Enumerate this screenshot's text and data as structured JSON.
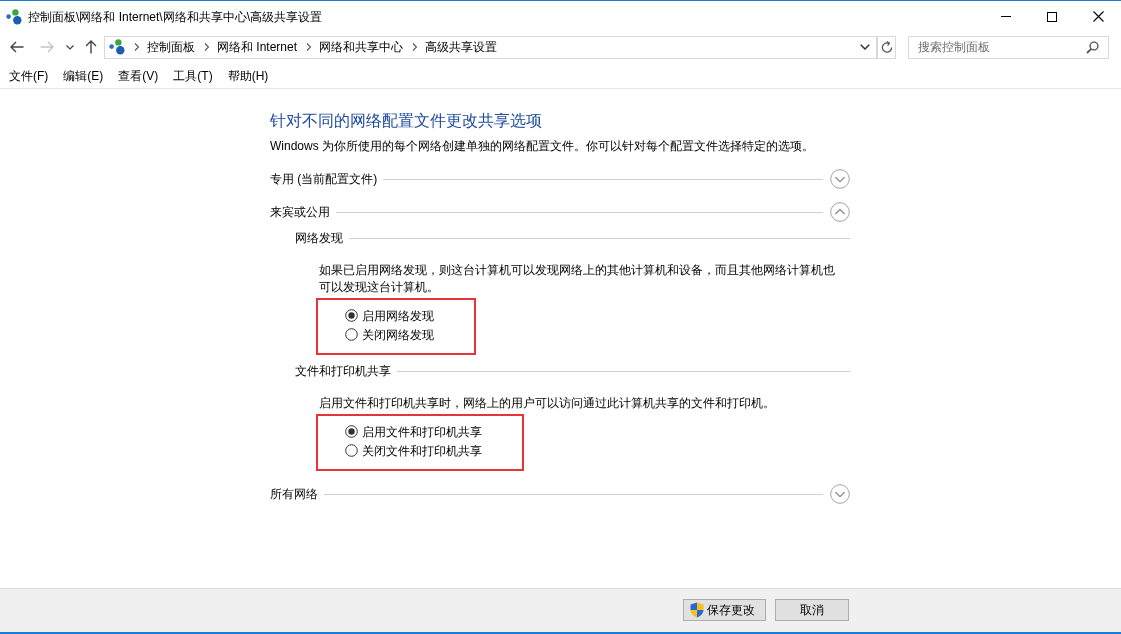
{
  "window": {
    "title": "控制面板\\网络和 Internet\\网络和共享中心\\高级共享设置"
  },
  "navigation": [
    {
      "kind": "back",
      "disabled": false
    },
    {
      "kind": "forward",
      "disabled": true
    },
    {
      "kind": "recent",
      "disabled": false
    },
    {
      "kind": "up",
      "disabled": false
    }
  ],
  "address_bar": {
    "breadcrumbs": [
      "控制面板",
      "网络和 Internet",
      "网络和共享中心",
      "高级共享设置"
    ]
  },
  "search": {
    "placeholder": "搜索控制面板"
  },
  "menu": [
    "文件(F)",
    "编辑(E)",
    "查看(V)",
    "工具(T)",
    "帮助(H)"
  ],
  "page": {
    "heading": "针对不同的网络配置文件更改共享选项",
    "description": "Windows 为你所使用的每个网络创建单独的网络配置文件。你可以针对每个配置文件选择特定的选项。"
  },
  "sections": [
    {
      "title": "专用 (当前配置文件)",
      "expanded": false
    },
    {
      "title": "来宾或公用",
      "expanded": true,
      "groups": [
        {
          "title": "网络发现",
          "description": "如果已启用网络发现，则这台计算机可以发现网络上的其他计算机和设备，而且其他网络计算机也可以发现这台计算机。",
          "highlighted": true,
          "options": [
            {
              "label": "启用网络发现",
              "selected": true
            },
            {
              "label": "关闭网络发现",
              "selected": false
            }
          ]
        },
        {
          "title": "文件和打印机共享",
          "description": "启用文件和打印机共享时，网络上的用户可以访问通过此计算机共享的文件和打印机。",
          "highlighted": true,
          "options": [
            {
              "label": "启用文件和打印机共享",
              "selected": true
            },
            {
              "label": "关闭文件和打印机共享",
              "selected": false
            }
          ]
        }
      ]
    },
    {
      "title": "所有网络",
      "expanded": false
    }
  ],
  "buttons": [
    {
      "label": "保存更改",
      "kind": "save"
    },
    {
      "label": "取消",
      "kind": "cancel"
    }
  ]
}
